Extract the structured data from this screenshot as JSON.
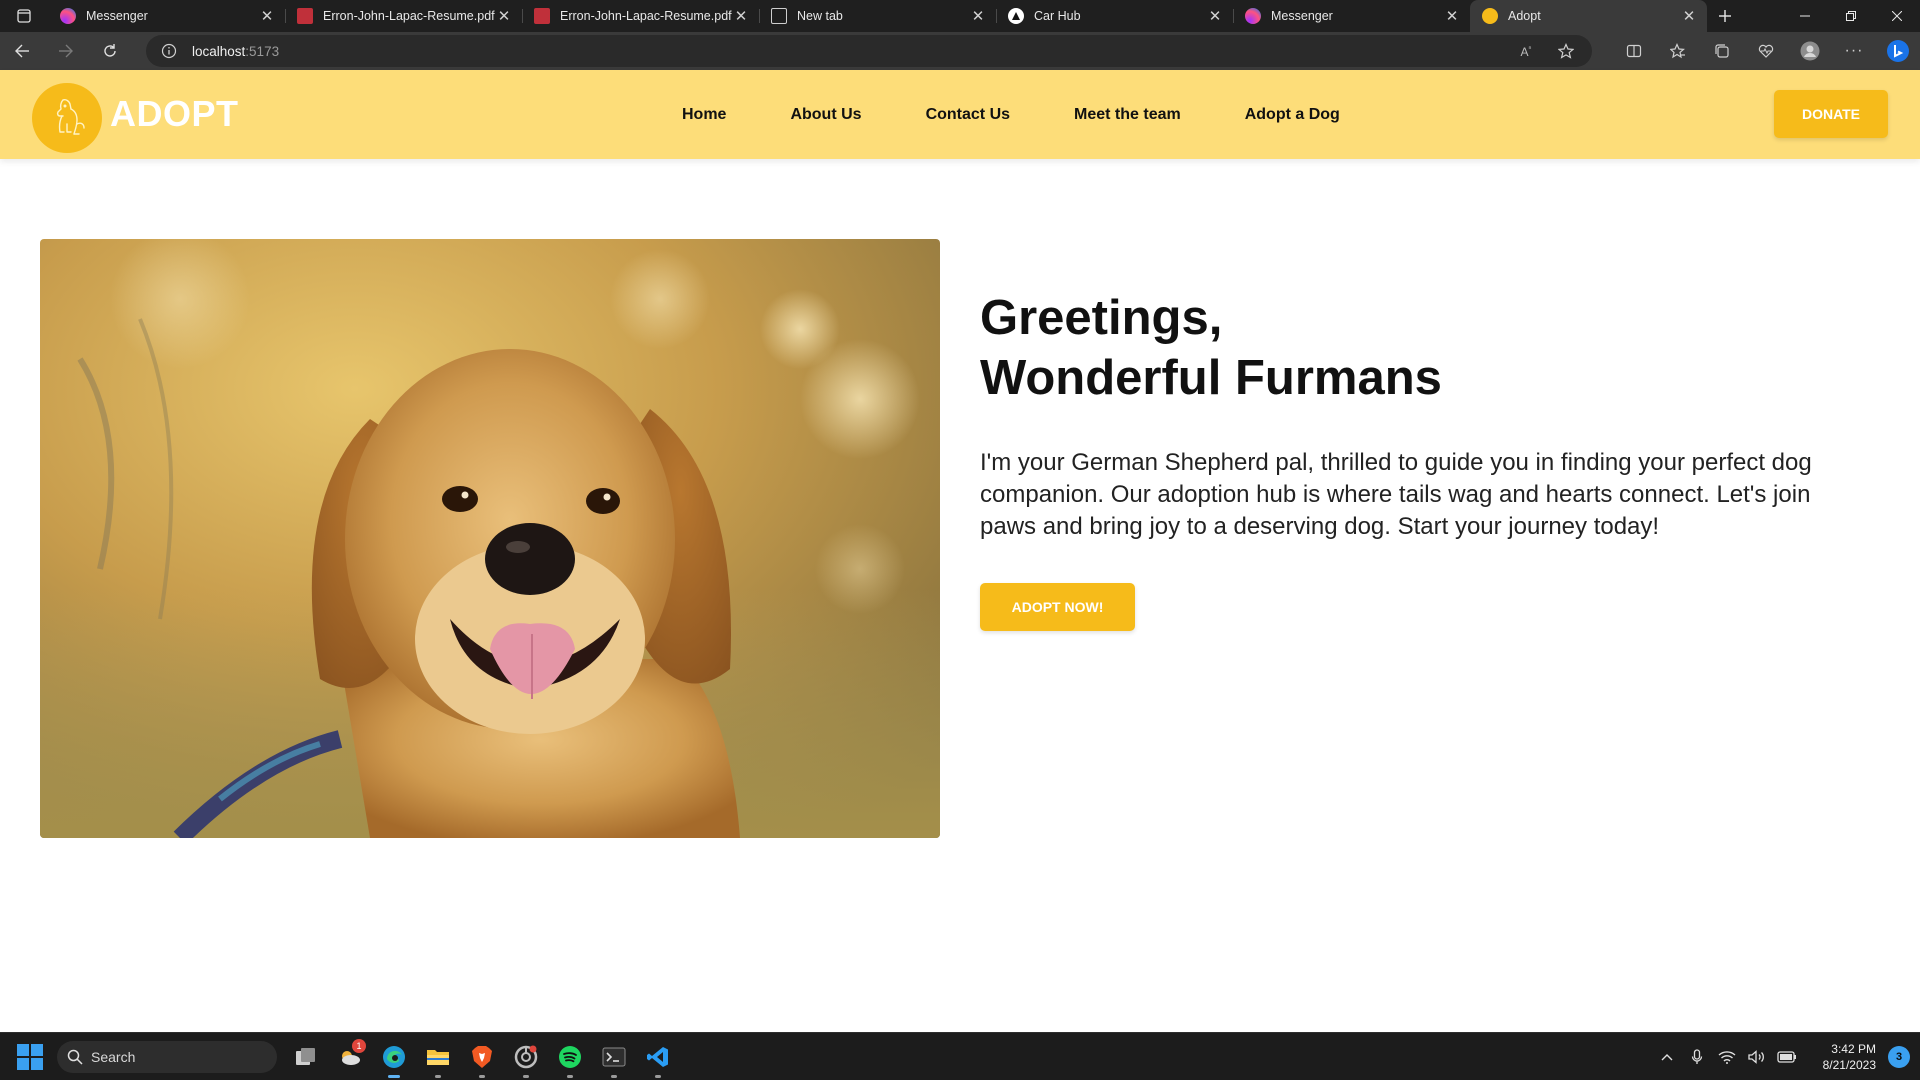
{
  "browser": {
    "tabs": [
      {
        "title": "Messenger",
        "icon": "messenger-icon"
      },
      {
        "title": "Erron-John-Lapac-Resume.pdf",
        "icon": "pdf-icon"
      },
      {
        "title": "Erron-John-Lapac-Resume.pdf",
        "icon": "pdf-icon"
      },
      {
        "title": "New tab",
        "icon": "new-tab-icon"
      },
      {
        "title": "Car Hub",
        "icon": "car-hub-icon"
      },
      {
        "title": "Messenger",
        "icon": "messenger-icon"
      },
      {
        "title": "Adopt",
        "icon": "adopt-favicon",
        "active": true
      }
    ],
    "url_host": "localhost",
    "url_port": ":5173"
  },
  "site": {
    "logo_text": "ADOPT",
    "nav": [
      "Home",
      "About Us",
      "Contact Us",
      "Meet the team",
      "Adopt a Dog"
    ],
    "donate_label": "DONATE",
    "hero": {
      "title_line1": "Greetings,",
      "title_line2": "Wonderful Furmans",
      "body": "I'm your German Shepherd pal, thrilled to guide you in finding your perfect dog companion. Our adoption hub is where tails wag and hearts connect. Let's join paws and bring joy to a deserving dog. Start your journey today!",
      "cta_label": "ADOPT NOW!"
    },
    "colors": {
      "header_bg": "#fddd79",
      "accent": "#f6bb1a"
    }
  },
  "taskbar": {
    "search_label": "Search",
    "time": "3:42 PM",
    "date": "8/21/2023",
    "notification_count": "3",
    "weather_badge": "1"
  }
}
